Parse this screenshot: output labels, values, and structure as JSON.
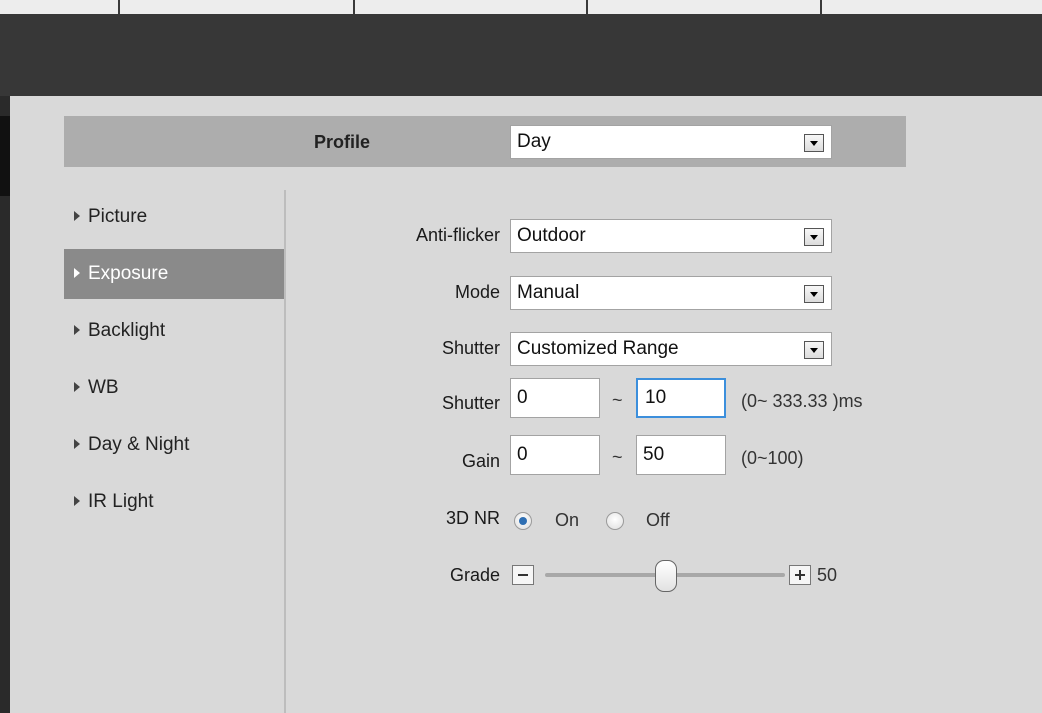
{
  "profile": {
    "label": "Profile",
    "value": "Day"
  },
  "sidebar": {
    "items": [
      {
        "label": "Picture"
      },
      {
        "label": "Exposure"
      },
      {
        "label": "Backlight"
      },
      {
        "label": "WB"
      },
      {
        "label": "Day & Night"
      },
      {
        "label": "IR Light"
      }
    ],
    "active_index": 1
  },
  "form": {
    "anti_flicker": {
      "label": "Anti-flicker",
      "value": "Outdoor"
    },
    "mode": {
      "label": "Mode",
      "value": "Manual"
    },
    "shutter_select": {
      "label": "Shutter",
      "value": "Customized Range"
    },
    "shutter_range": {
      "label": "Shutter",
      "min": "0",
      "sep": "~",
      "max": "10",
      "hint": "(0~ 333.33 )ms"
    },
    "gain_range": {
      "label": "Gain",
      "min": "0",
      "sep": "~",
      "max": "50",
      "hint": "(0~100)"
    },
    "nr3d": {
      "label": "3D NR",
      "on_label": "On",
      "off_label": "Off",
      "selected": "On"
    },
    "grade": {
      "label": "Grade",
      "value": "50",
      "max": 100
    }
  },
  "colors": {
    "active_nav": "#8a8a8a",
    "focus_border": "#3c8fdc",
    "radio_dot": "#2f6fb3"
  }
}
